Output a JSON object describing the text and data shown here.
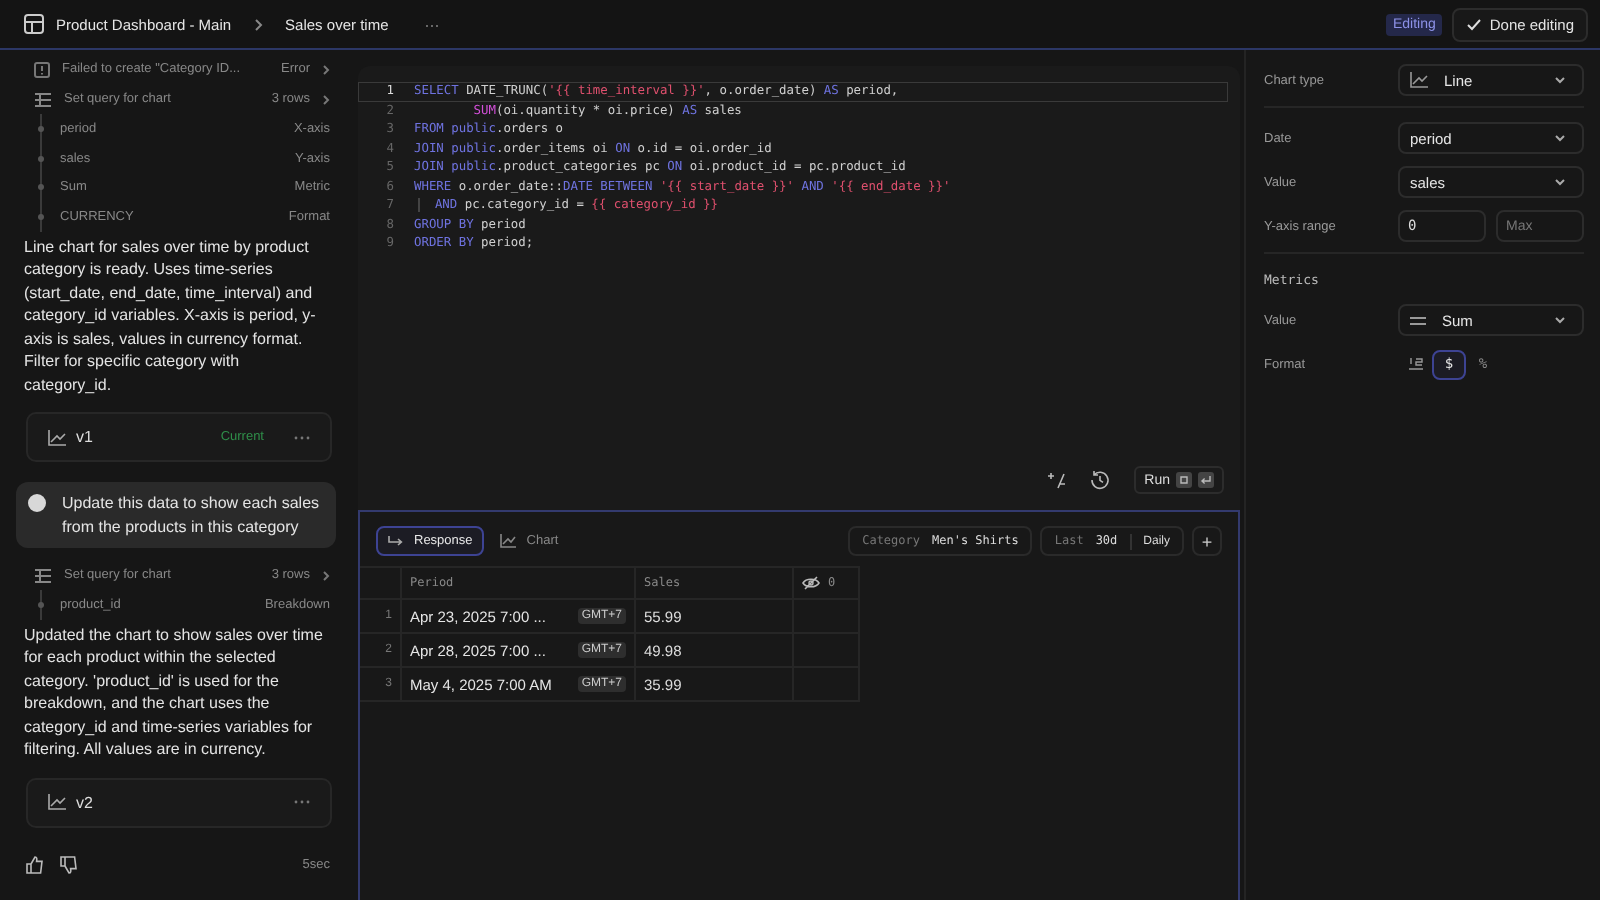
{
  "breadcrumb": [
    {
      "label": "Product Dashboard - Main"
    },
    {
      "label": "Sales over time"
    }
  ],
  "more_label": "···",
  "mode_badge": "Editing",
  "done_button": "Done editing",
  "chat": [
    {
      "kind": "tool",
      "label": "Failed to create \"Category ID...",
      "status": "Error",
      "error": true
    },
    {
      "kind": "tool",
      "label": "Set query for chart",
      "status": "3 rows",
      "error": false,
      "children": [
        {
          "name": "period",
          "role": "X-axis"
        },
        {
          "name": "sales",
          "role": "Y-axis"
        },
        {
          "name": "Sum",
          "role": "Metric"
        },
        {
          "name": "CURRENCY",
          "role": "Format"
        }
      ]
    },
    {
      "kind": "text",
      "text": "Line chart for sales over time by product category is ready. Uses time-series (start_date, end_date, time_interval) and category_id variables. X-axis is period, y-axis is sales, values in currency format. Filter for specific category with category_id."
    },
    {
      "kind": "version",
      "label": "v1",
      "badge": "Current"
    },
    {
      "kind": "user",
      "text": "Update this data to show each sales from the products in this category"
    },
    {
      "kind": "tool",
      "label": "Set query for chart",
      "status": "3 rows",
      "error": false,
      "children": [
        {
          "name": "product_id",
          "role": "Breakdown"
        }
      ]
    },
    {
      "kind": "text",
      "text": "Updated the chart to show sales over time for each product within the selected category. 'product_id' is used for the breakdown, and the chart uses the category_id and time-series variables for filtering. All values are in currency."
    },
    {
      "kind": "version",
      "label": "v2"
    },
    {
      "kind": "feedback",
      "time": "5sec"
    }
  ],
  "editor": {
    "lines": [
      {
        "number": "1",
        "selected": true,
        "kind": "clause",
        "tokens": [
          {
            "t": "SELECT",
            "kind": "keyword"
          },
          {
            "t": "DATE_TRUNC(",
            "kind": "plain",
            "gap": true
          },
          {
            "t": "'{{ time_interval }}'",
            "kind": "variable"
          },
          {
            "t": ", o.order_date)",
            "kind": "plain"
          },
          {
            "t": "AS",
            "kind": "keyword",
            "gap": true
          },
          {
            "t": "period,",
            "kind": "plain",
            "gap": true
          }
        ]
      },
      {
        "number": "2",
        "selected": false,
        "kind": "indented",
        "tokens": [
          {
            "t": "SUM",
            "kind": "function"
          },
          {
            "t": "(oi.quantity * oi.price)",
            "kind": "plain"
          },
          {
            "t": "AS",
            "kind": "keyword",
            "gap": true
          },
          {
            "t": "sales",
            "kind": "plain",
            "gap": true
          }
        ]
      },
      {
        "number": "3",
        "selected": false,
        "kind": "clause",
        "tokens": [
          {
            "t": "FROM",
            "kind": "keyword"
          },
          {
            "t": "public",
            "kind": "keyword",
            "gap": true
          },
          {
            "t": ".orders o",
            "kind": "plain"
          }
        ]
      },
      {
        "number": "4",
        "selected": false,
        "kind": "clause",
        "tokens": [
          {
            "t": "JOIN",
            "kind": "keyword"
          },
          {
            "t": "public",
            "kind": "keyword",
            "gap": true
          },
          {
            "t": ".order_items oi",
            "kind": "plain"
          },
          {
            "t": "ON",
            "kind": "keyword",
            "gap": true
          },
          {
            "t": "o.id = oi.order_id",
            "kind": "plain",
            "gap": true
          }
        ]
      },
      {
        "number": "5",
        "selected": false,
        "kind": "clause",
        "tokens": [
          {
            "t": "JOIN",
            "kind": "keyword"
          },
          {
            "t": "public",
            "kind": "keyword",
            "gap": true
          },
          {
            "t": ".product_categories pc",
            "kind": "plain"
          },
          {
            "t": "ON",
            "kind": "keyword",
            "gap": true
          },
          {
            "t": "oi.product_id = pc.product_id",
            "kind": "plain",
            "gap": true
          }
        ]
      },
      {
        "number": "6",
        "selected": false,
        "kind": "clause",
        "tokens": [
          {
            "t": "WHERE",
            "kind": "keyword"
          },
          {
            "t": "o.order_date::",
            "kind": "plain",
            "gap": true
          },
          {
            "t": "DATE",
            "kind": "keyword"
          },
          {
            "t": "BETWEEN",
            "kind": "keyword",
            "gap": true
          },
          {
            "t": "'{{ start_date }}'",
            "kind": "variable",
            "gap": true
          },
          {
            "t": "AND",
            "kind": "keyword",
            "gap": true
          },
          {
            "t": "'{{ end_date }}'",
            "kind": "variable",
            "gap": true
          }
        ]
      },
      {
        "number": "7",
        "selected": false,
        "kind": "nested",
        "tokens": [
          {
            "t": "AND",
            "kind": "keyword"
          },
          {
            "t": "pc.category_id =",
            "kind": "plain",
            "gap": true
          },
          {
            "t": "{{ category_id }}",
            "kind": "variable",
            "gap": true
          }
        ]
      },
      {
        "number": "8",
        "selected": false,
        "kind": "clause",
        "tokens": [
          {
            "t": "GROUP BY",
            "kind": "keyword"
          },
          {
            "t": "period",
            "kind": "plain",
            "gap": true
          }
        ]
      },
      {
        "number": "9",
        "selected": false,
        "kind": "clause",
        "tokens": [
          {
            "t": "ORDER BY",
            "kind": "keyword"
          },
          {
            "t": "period;",
            "kind": "plain",
            "gap": true
          }
        ]
      }
    ],
    "run_button": "Run"
  },
  "results": {
    "tabs": [
      {
        "label": "Response",
        "selected": true
      },
      {
        "label": "Chart",
        "selected": false
      }
    ],
    "category_filter": {
      "label": "Category",
      "value": "Men's Shirts"
    },
    "range_filter": {
      "label": "Last",
      "value": "30d",
      "interval": "Daily"
    },
    "add_label": "+",
    "columns": [
      "Period",
      "Sales"
    ],
    "hidden_count": "0",
    "rows": [
      {
        "index": "1",
        "period": "Apr 23, 2025 7:00 ...",
        "tz": "GMT+7",
        "sales": "55.99"
      },
      {
        "index": "2",
        "period": "Apr 28, 2025 7:00 ...",
        "tz": "GMT+7",
        "sales": "49.98"
      },
      {
        "index": "3",
        "period": "May 4, 2025 7:00 AM",
        "tz": "GMT+7",
        "sales": "35.99"
      }
    ]
  },
  "settings": [
    {
      "kind": "select",
      "label": "Chart type",
      "value": "Line"
    },
    {
      "kind": "divider"
    },
    {
      "kind": "select",
      "label": "Date",
      "value": "period"
    },
    {
      "kind": "select",
      "label": "Value",
      "value": "sales"
    },
    {
      "kind": "range",
      "label": "Y-axis range",
      "min": "0",
      "max_placeholder": "Max"
    },
    {
      "kind": "divider"
    },
    {
      "kind": "heading",
      "label": "Metrics"
    },
    {
      "kind": "select",
      "label": "Value",
      "value": "Sum"
    },
    {
      "kind": "format",
      "label": "Format",
      "options": [
        {
          "kind": "decimals",
          "selected": false
        },
        {
          "kind": "text",
          "label": "$",
          "selected": true
        },
        {
          "kind": "text",
          "label": "%",
          "selected": false
        }
      ]
    }
  ]
}
